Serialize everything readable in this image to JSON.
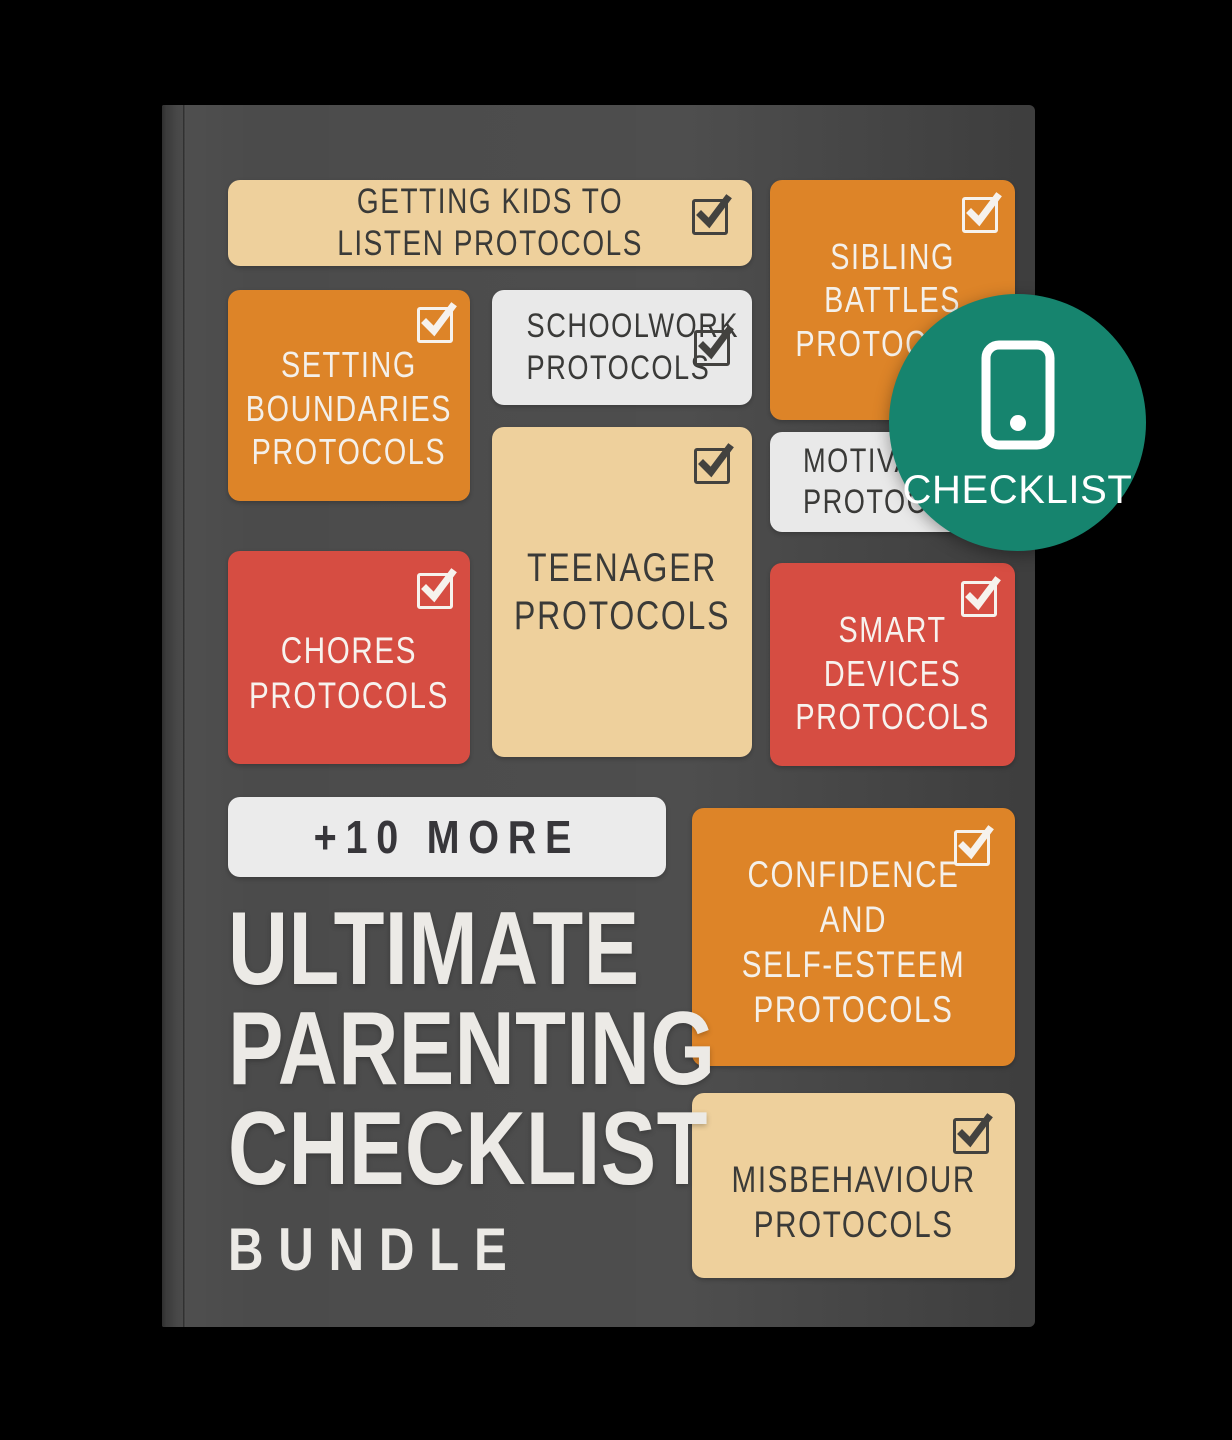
{
  "product": {
    "title_lines": [
      "ULTIMATE",
      "PARENTING",
      "CHECKLIST"
    ],
    "subtitle": "BUNDLE",
    "more_pill": "+10 MORE"
  },
  "badge": {
    "label": "CHECKLIST",
    "icon": "mobile-phone-icon",
    "color": "#16846e"
  },
  "colors": {
    "book": "#4b4b4b",
    "tan": "#eed09c",
    "orange": "#dd8428",
    "red": "#d64d42",
    "white": "#e9e9e9",
    "teal": "#16846e",
    "background": "#000000"
  },
  "cards": [
    {
      "id": "getting-kids-to-listen",
      "label": "GETTING KIDS TO\nLISTEN PROTOCOLS",
      "color": "tan",
      "checked": true
    },
    {
      "id": "sibling-battles",
      "label": "SIBLING\nBATTLES\nPROTOCOLS",
      "color": "orange",
      "checked": true
    },
    {
      "id": "setting-boundaries",
      "label": "SETTING\nBOUNDARIES\nPROTOCOLS",
      "color": "orange",
      "checked": true
    },
    {
      "id": "schoolwork",
      "label": "SCHOOLWORK\nPROTOCOLS",
      "color": "white",
      "checked": true
    },
    {
      "id": "motivation",
      "label": "MOTIVATION\nPROTOCOLS",
      "color": "white",
      "checked": true
    },
    {
      "id": "teenager",
      "label": "TEENAGER\nPROTOCOLS",
      "color": "tan",
      "checked": true
    },
    {
      "id": "chores",
      "label": "CHORES\nPROTOCOLS",
      "color": "red",
      "checked": true
    },
    {
      "id": "smart-devices",
      "label": "SMART\nDEVICES\nPROTOCOLS",
      "color": "red",
      "checked": true
    },
    {
      "id": "confidence-self-esteem",
      "label": "CONFIDENCE AND\nSELF-ESTEEM\nPROTOCOLS",
      "color": "orange",
      "checked": true
    },
    {
      "id": "misbehaviour",
      "label": "MISBEHAVIOUR\nPROTOCOLS",
      "color": "tan",
      "checked": true
    }
  ]
}
